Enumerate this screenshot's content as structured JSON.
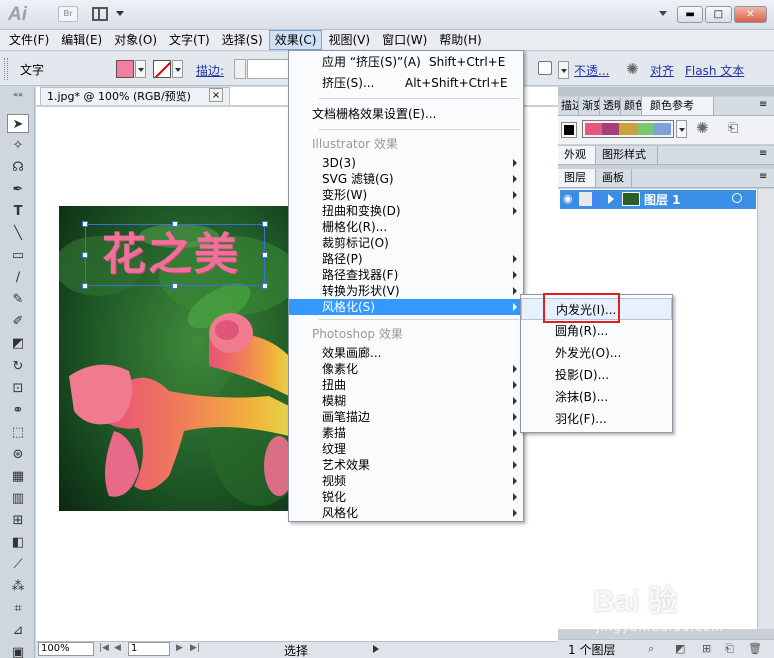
{
  "app": {
    "logo": "Ai",
    "bridge_label": "Br"
  },
  "window_controls": {
    "minimize": "▬",
    "maximize": "□",
    "close": "✕"
  },
  "menubar": [
    "文件(F)",
    "编辑(E)",
    "对象(O)",
    "文字(T)",
    "选择(S)",
    "效果(C)",
    "视图(V)",
    "窗口(W)",
    "帮助(H)"
  ],
  "control_bar": {
    "label": "文字",
    "fill_color": "#f27fa0",
    "stroke_label": "描边:",
    "opacity_label": "不透...",
    "align_label": "对齐",
    "flash_text_label": "Flash 文本"
  },
  "document": {
    "tab_title": "1.jpg* @ 100% (RGB/预览)",
    "close": "×"
  },
  "artwork": {
    "title_text": "花之美",
    "text_color": "#f0709a"
  },
  "statusbar": {
    "zoom": "100%",
    "page": "1",
    "status": "选择"
  },
  "effect_menu": {
    "items": [
      {
        "label": "应用 “挤压(S)”(A)",
        "shortcut": "Shift+Ctrl+E"
      },
      {
        "label": "挤压(S)...",
        "shortcut": "Alt+Shift+Ctrl+E"
      },
      {
        "label": "文档栅格效果设置(E)..."
      },
      {
        "label": "Illustrator 效果",
        "section": true
      },
      {
        "label": "3D(3)",
        "sub": true
      },
      {
        "label": "SVG 滤镜(G)",
        "sub": true
      },
      {
        "label": "变形(W)",
        "sub": true
      },
      {
        "label": "扭曲和变换(D)",
        "sub": true
      },
      {
        "label": "栅格化(R)..."
      },
      {
        "label": "裁剪标记(O)"
      },
      {
        "label": "路径(P)",
        "sub": true
      },
      {
        "label": "路径查找器(F)",
        "sub": true
      },
      {
        "label": "转换为形状(V)",
        "sub": true
      },
      {
        "label": "风格化(S)",
        "sub": true,
        "highlighted": true
      },
      {
        "label": "Photoshop 效果",
        "section": true
      },
      {
        "label": "效果画廊..."
      },
      {
        "label": "像素化",
        "sub": true
      },
      {
        "label": "扭曲",
        "sub": true
      },
      {
        "label": "模糊",
        "sub": true
      },
      {
        "label": "画笔描边",
        "sub": true
      },
      {
        "label": "素描",
        "sub": true
      },
      {
        "label": "纹理",
        "sub": true
      },
      {
        "label": "艺术效果",
        "sub": true
      },
      {
        "label": "视频",
        "sub": true
      },
      {
        "label": "锐化",
        "sub": true
      },
      {
        "label": "风格化",
        "sub": true
      }
    ]
  },
  "stylize_submenu": [
    "内发光(I)...",
    "圆角(R)...",
    "外发光(O)...",
    "投影(D)...",
    "涂抹(B)...",
    "羽化(F)..."
  ],
  "panels": {
    "top_tabs": [
      "描边",
      "渐变",
      "透明",
      "颜色",
      "颜色参考"
    ],
    "swatches": [
      "#e8557f",
      "#a63e7a",
      "#c9a23c",
      "#78c96b",
      "#7fa0d8"
    ],
    "appearance_tabs": [
      "外观",
      "图形样式"
    ],
    "layers_tabs": [
      "图层",
      "画板"
    ],
    "layer_name": "图层 1",
    "footer": "1 个图层"
  },
  "watermark": {
    "logo": "Bai  验",
    "sub": "jingyan.baidu.com"
  }
}
